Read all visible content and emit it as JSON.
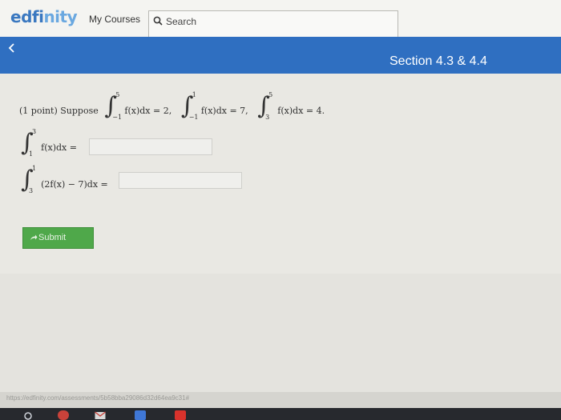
{
  "header": {
    "logo_main": "edfi",
    "logo_accent": "nity",
    "my_courses": "My Courses",
    "search_placeholder": "Search"
  },
  "nav": {
    "section_title": "Section 4.3 & 4.4"
  },
  "problem": {
    "points": "(1 point) Suppose",
    "given_1": {
      "upper": "5",
      "lower": "−1",
      "expr": "f(x)dx = 2,"
    },
    "given_2": {
      "upper": "1",
      "lower": "−1",
      "expr": "f(x)dx = 7,"
    },
    "given_3": {
      "upper": "5",
      "lower": "3",
      "expr": "f(x)dx = 4."
    },
    "part_a": {
      "upper": "3",
      "lower": "1",
      "expr": "f(x)dx ="
    },
    "part_b": {
      "upper": "1",
      "lower": "3",
      "expr": "(2f(x) − 7)dx ="
    },
    "answer_a_value": "",
    "answer_b_value": ""
  },
  "actions": {
    "submit_label": "Submit"
  },
  "status": {
    "url": "https://edfinity.com/assessments/5b58bba29086d32d64ea9c31#"
  },
  "colors": {
    "brand_blue": "#2f6fc1",
    "submit_green": "#4fa84a"
  }
}
